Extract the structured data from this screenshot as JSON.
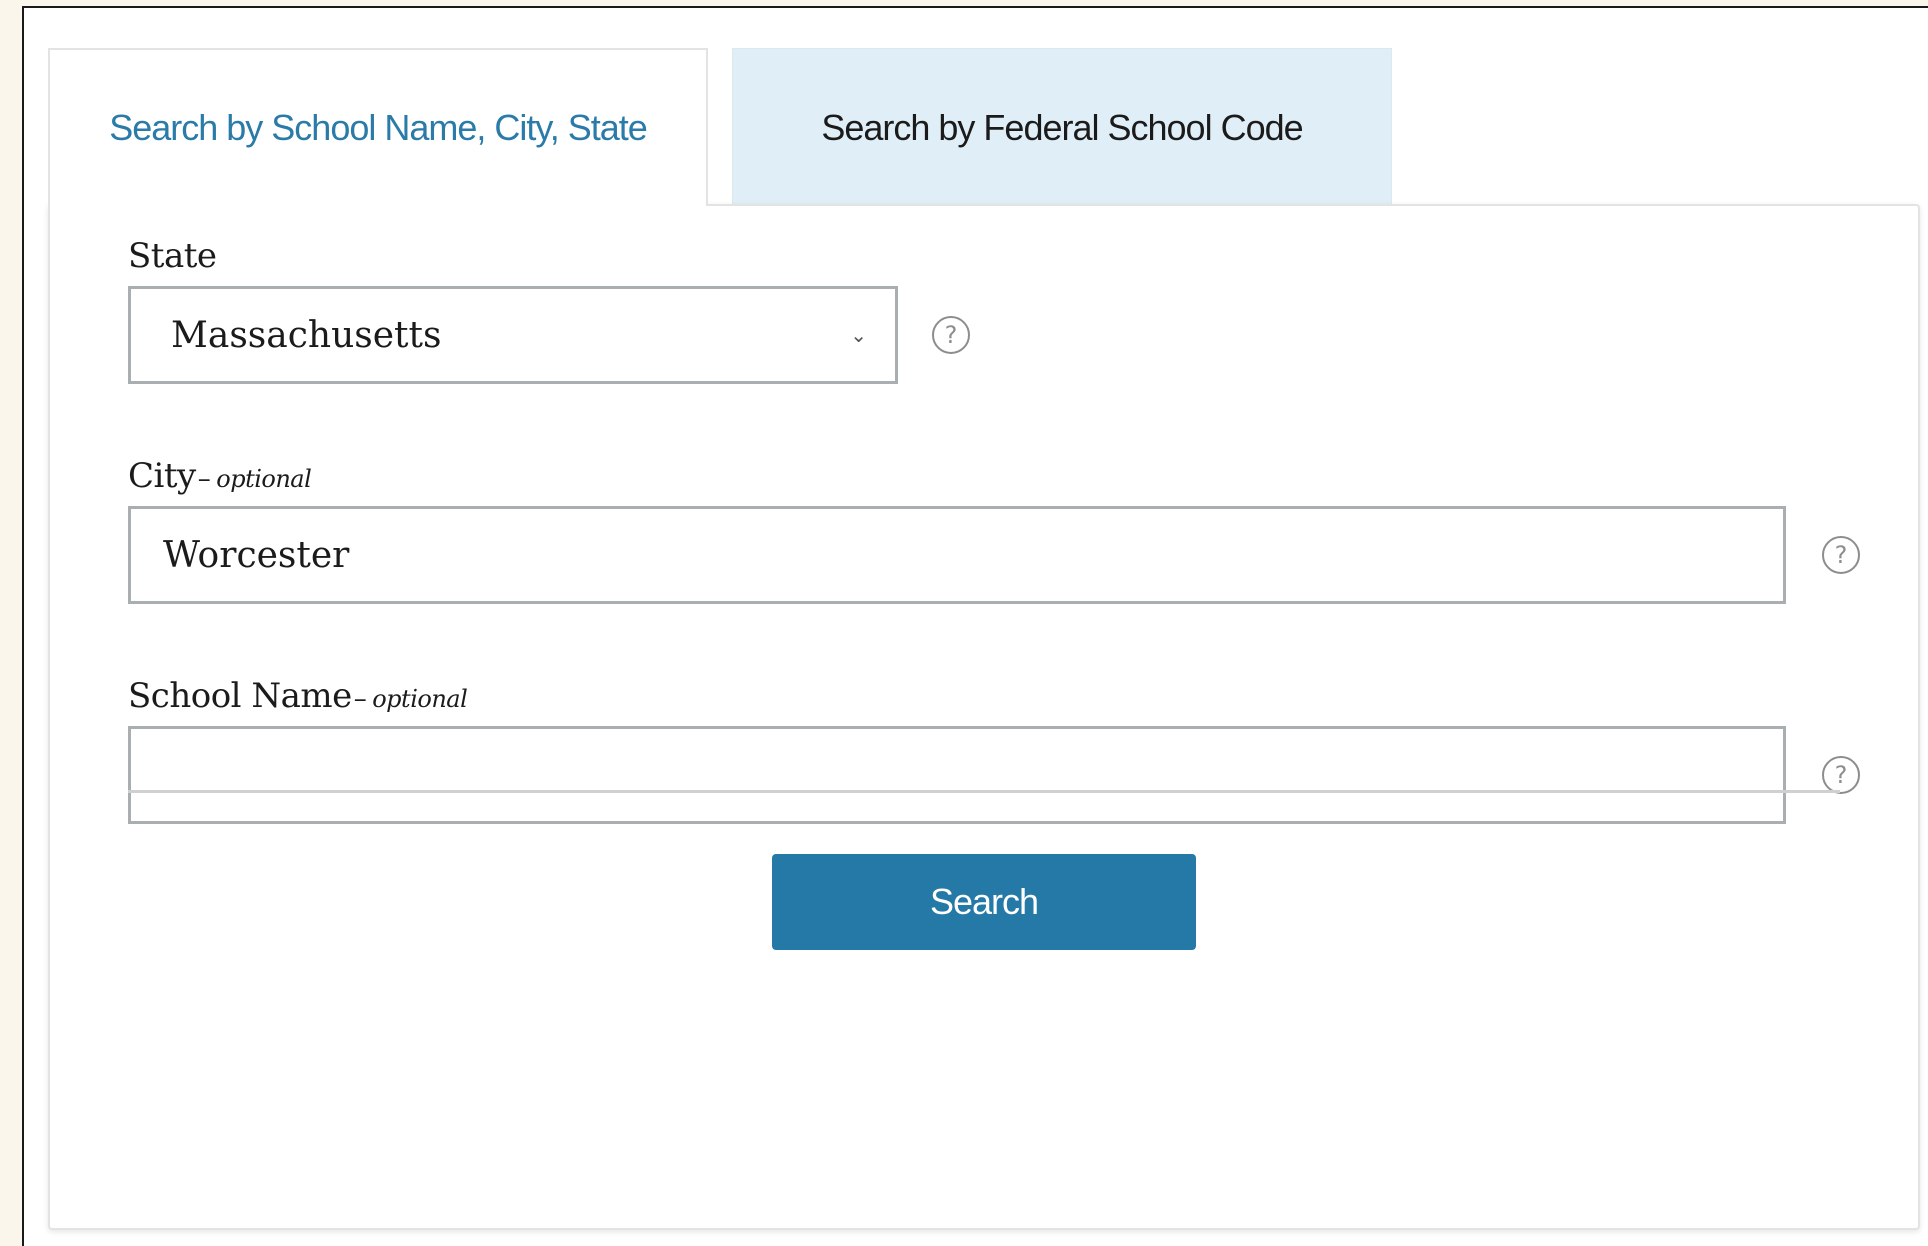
{
  "tabs": [
    {
      "label": "Search by School Name, City, State",
      "active": true
    },
    {
      "label": "Search by Federal School Code",
      "active": false
    }
  ],
  "form": {
    "state": {
      "label": "State",
      "value": "Massachusetts",
      "help_icon": "question-circle-icon"
    },
    "city": {
      "label": "City",
      "optional_text": "optional",
      "value": "Worcester",
      "help_icon": "question-circle-icon"
    },
    "school_name": {
      "label": "School Name",
      "optional_text": "optional",
      "value": "",
      "help_icon": "question-circle-icon"
    },
    "dash": "–",
    "help_glyph": "?"
  },
  "actions": {
    "search_label": "Search"
  },
  "colors": {
    "accent": "#2479a6",
    "active_tab_text": "#2a7ba8",
    "inactive_tab_bg": "#e0eff7",
    "page_bg": "#fbf6ec"
  }
}
